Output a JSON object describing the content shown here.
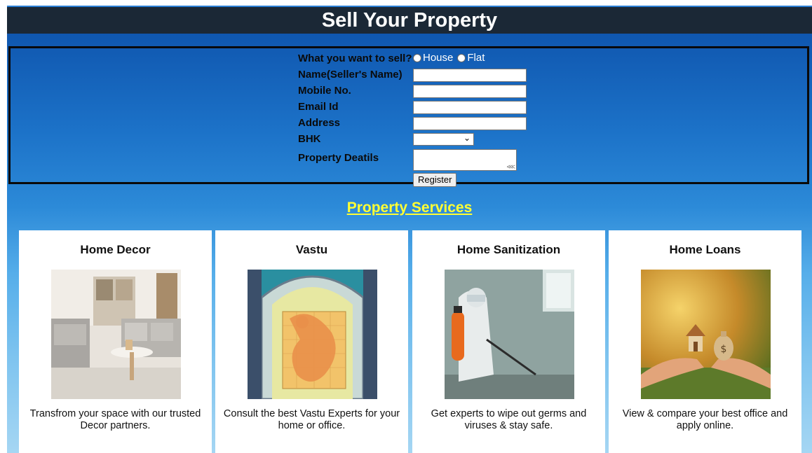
{
  "header": {
    "title": "Sell Your Property"
  },
  "form": {
    "sell_label": "What you want to sell?",
    "sell_options": [
      "House",
      "Flat"
    ],
    "name_label": "Name(Seller's Name)",
    "mobile_label": "Mobile No.",
    "email_label": "Email Id",
    "address_label": "Address",
    "bhk_label": "BHK",
    "details_label": "Property Deatils",
    "register_label": "Register"
  },
  "services": {
    "title": "Property Services",
    "cards": [
      {
        "title": "Home Decor",
        "desc": "Transfrom your space with our trusted Decor partners.",
        "image_icon": "living-room-image"
      },
      {
        "title": "Vastu",
        "desc": "Consult the best Vastu Experts for your home or office.",
        "image_icon": "vastu-image"
      },
      {
        "title": "Home Sanitization",
        "desc": "Get experts to wipe out germs and viruses & stay safe.",
        "image_icon": "sanitization-image"
      },
      {
        "title": "Home Loans",
        "desc": "View & compare your best office and apply online.",
        "image_icon": "home-loan-image"
      }
    ]
  },
  "colors": {
    "header_bg": "#1b2836",
    "services_title": "#ffff33"
  }
}
